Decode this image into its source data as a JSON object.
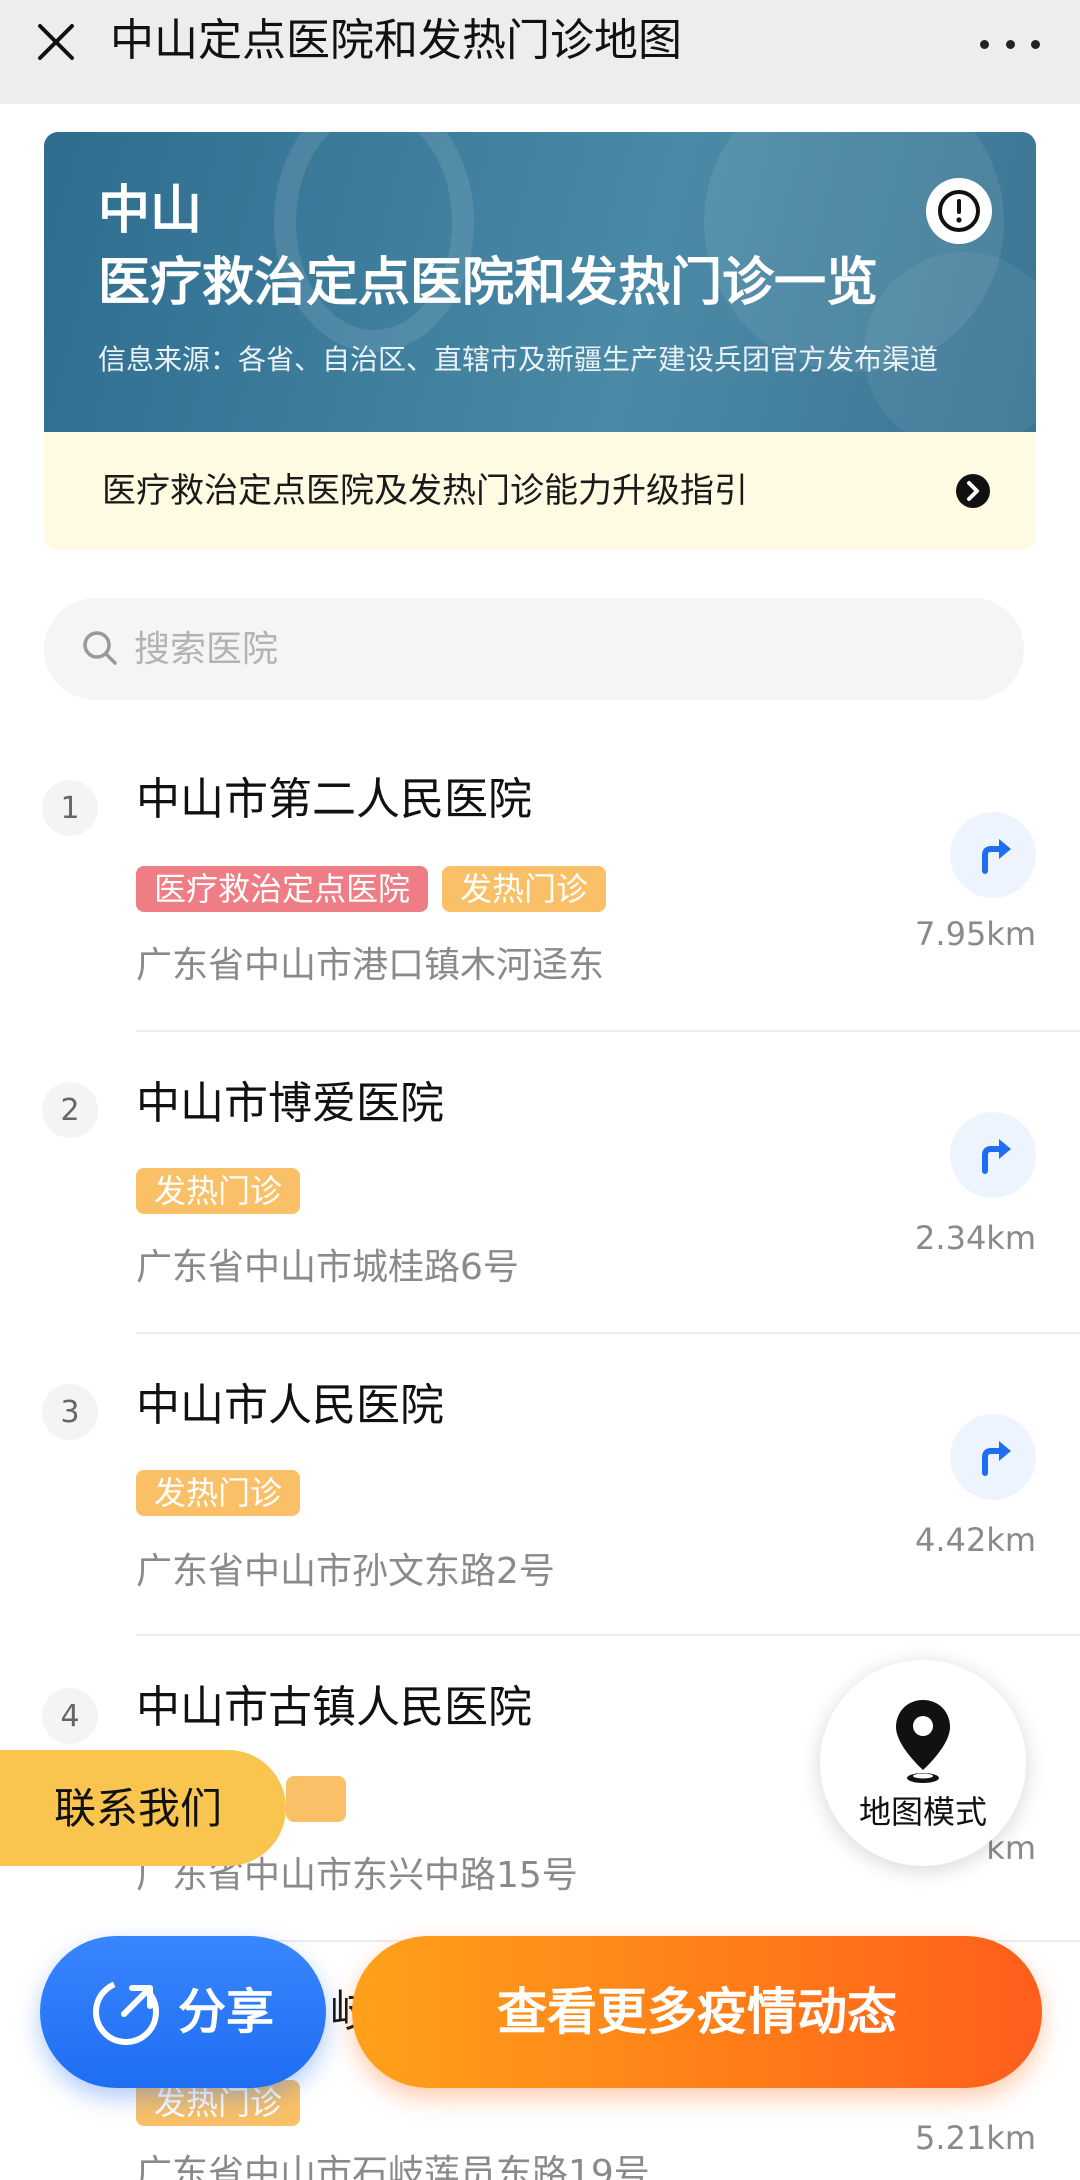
{
  "topbar": {
    "title": "中山定点医院和发热门诊地图"
  },
  "banner": {
    "city": "中山",
    "title": "医疗救治定点医院和发热门诊一览",
    "source": "信息来源：各省、自治区、直辖市及新疆生产建设兵团官方发布渠道"
  },
  "guide": {
    "text": "医疗救治定点医院及发热门诊能力升级指引"
  },
  "search": {
    "placeholder": "搜索医院"
  },
  "hospitals": [
    {
      "rank": "1",
      "name": "中山市第二人民医院",
      "tags": [
        "医疗救治定点医院",
        "发热门诊"
      ],
      "address": "广东省中山市港口镇木河迳东",
      "distance": "7.95km"
    },
    {
      "rank": "2",
      "name": "中山市博爱医院",
      "tags": [
        "发热门诊"
      ],
      "address": "广东省中山市城桂路6号",
      "distance": "2.34km"
    },
    {
      "rank": "3",
      "name": "中山市人民医院",
      "tags": [
        "发热门诊"
      ],
      "address": "广东省中山市孙文东路2号",
      "distance": "4.42km"
    },
    {
      "rank": "4",
      "name": "中山市古镇人民医院",
      "tags": [],
      "address": "广东省中山市东兴中路15号",
      "distance": "km"
    },
    {
      "rank": "",
      "name": "岐",
      "tags": [
        "发热门诊"
      ],
      "address": "广东省中山市石岐莲员东路19号",
      "distance": "5.21km"
    }
  ],
  "map_mode": {
    "label": "地图模式"
  },
  "contact": {
    "label": "联系我们"
  },
  "actions": {
    "share_label": "分享",
    "more_label": "查看更多疫情动态"
  },
  "colors": {
    "accent_blue": "#1f6df2",
    "accent_orange": "#ff7a18",
    "tag_red": "#ef7d85",
    "tag_orange": "#f9c067",
    "banner_blue": "#3e7d9c",
    "guide_bg": "#fffbe3"
  }
}
